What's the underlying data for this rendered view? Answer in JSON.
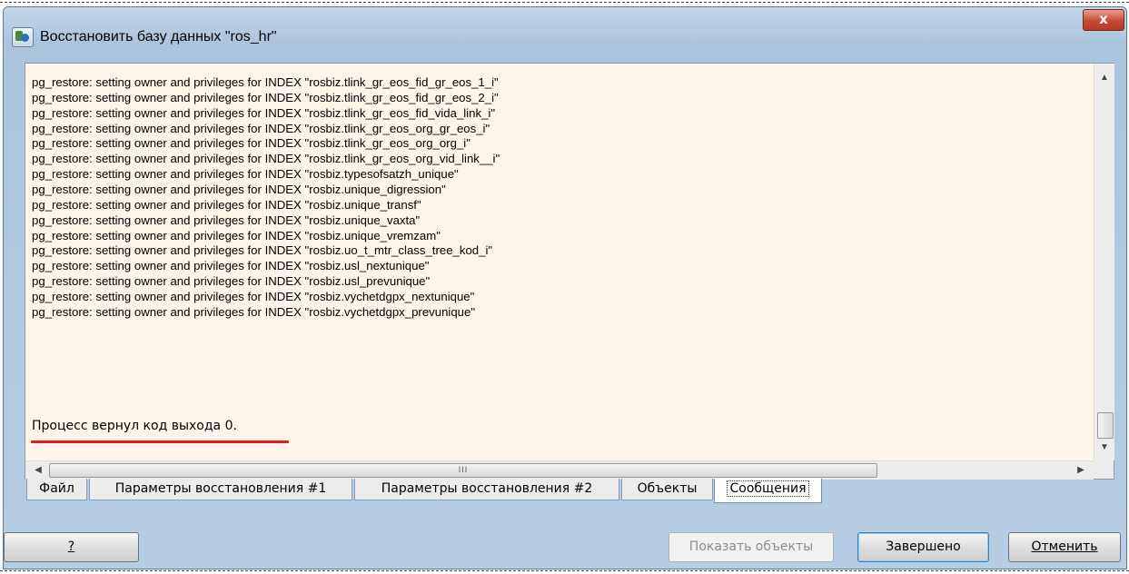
{
  "window": {
    "title": "Восстановить базу данных \"ros_hr\"",
    "close_label": "x"
  },
  "log": {
    "lines": [
      "pg_restore: setting owner and privileges for INDEX \"rosbiz.tlink_gr_eos_fid_gr_eos_1_i\"",
      "pg_restore: setting owner and privileges for INDEX \"rosbiz.tlink_gr_eos_fid_gr_eos_2_i\"",
      "pg_restore: setting owner and privileges for INDEX \"rosbiz.tlink_gr_eos_fid_vida_link_i\"",
      "pg_restore: setting owner and privileges for INDEX \"rosbiz.tlink_gr_eos_org_gr_eos_i\"",
      "pg_restore: setting owner and privileges for INDEX \"rosbiz.tlink_gr_eos_org_org_i\"",
      "pg_restore: setting owner and privileges for INDEX \"rosbiz.tlink_gr_eos_org_vid_link__i\"",
      "pg_restore: setting owner and privileges for INDEX \"rosbiz.typesofsatzh_unique\"",
      "pg_restore: setting owner and privileges for INDEX \"rosbiz.unique_digression\"",
      "pg_restore: setting owner and privileges for INDEX \"rosbiz.unique_transf\"",
      "pg_restore: setting owner and privileges for INDEX \"rosbiz.unique_vaxta\"",
      "pg_restore: setting owner and privileges for INDEX \"rosbiz.unique_vremzam\"",
      "pg_restore: setting owner and privileges for INDEX \"rosbiz.uo_t_mtr_class_tree_kod_i\"",
      "pg_restore: setting owner and privileges for INDEX \"rosbiz.usl_nextunique\"",
      "pg_restore: setting owner and privileges for INDEX \"rosbiz.usl_prevunique\"",
      "pg_restore: setting owner and privileges for INDEX \"rosbiz.vychetdgpx_nextunique\"",
      "pg_restore: setting owner and privileges for INDEX \"rosbiz.vychetdgpx_prevunique\""
    ],
    "exit_message": "Процесс вернул код выхода 0.",
    "hscroll_grip": "III"
  },
  "tabs": [
    {
      "label": "Файл"
    },
    {
      "label": "Параметры восстановления #1"
    },
    {
      "label": "Параметры восстановления #2"
    },
    {
      "label": "Объекты"
    },
    {
      "label": "Сообщения",
      "active": true
    }
  ],
  "buttons": {
    "help": "?",
    "show_objects": "Показать объекты",
    "done": "Завершено",
    "cancel": "Отменить"
  },
  "colors": {
    "log_background": "#fdf4ea",
    "highlight_underline": "#e21b1b",
    "close_button": "#c94a33"
  }
}
